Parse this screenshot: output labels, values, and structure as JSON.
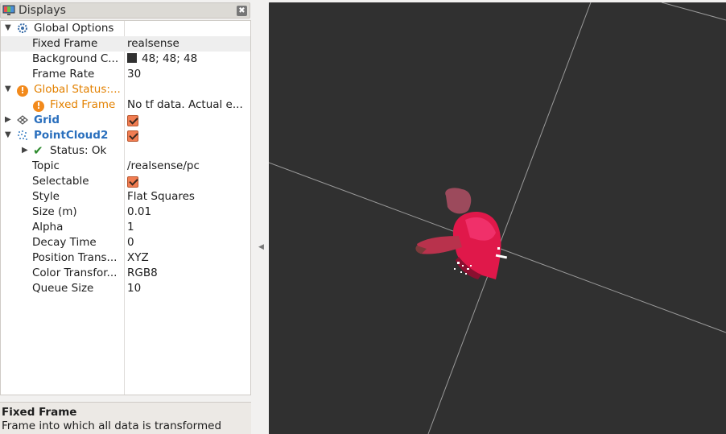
{
  "panel": {
    "title": "Displays",
    "description_title": "Fixed Frame",
    "description_text": "Frame into which all data is transformed"
  },
  "tree": {
    "global_options": {
      "label": "Global Options",
      "fixed_frame": {
        "label": "Fixed Frame",
        "value": "realsense"
      },
      "background_color": {
        "label": "Background C...",
        "value": "48; 48; 48",
        "color": "#303030"
      },
      "frame_rate": {
        "label": "Frame Rate",
        "value": "30"
      }
    },
    "global_status": {
      "label": "Global Status:...",
      "fixed_frame": {
        "label": "Fixed Frame",
        "value": "No tf data.  Actual e..."
      }
    },
    "grid": {
      "label": "Grid",
      "enabled": true
    },
    "pointcloud2": {
      "label": "PointCloud2",
      "enabled": true,
      "status": "Status: Ok",
      "props": [
        {
          "label": "Topic",
          "value": "/realsense/pc"
        },
        {
          "label": "Selectable",
          "value": "",
          "checkbox": true
        },
        {
          "label": "Style",
          "value": "Flat Squares"
        },
        {
          "label": "Size (m)",
          "value": "0.01"
        },
        {
          "label": "Alpha",
          "value": "1"
        },
        {
          "label": "Decay Time",
          "value": "0"
        },
        {
          "label": "Position Trans...",
          "value": "XYZ"
        },
        {
          "label": "Color Transfor...",
          "value": "RGB8"
        },
        {
          "label": "Queue Size",
          "value": "10"
        }
      ]
    }
  },
  "viewport": {
    "background": "#303030",
    "grid_color": "#9a9a9a",
    "cloud_color": "#e0184a"
  }
}
